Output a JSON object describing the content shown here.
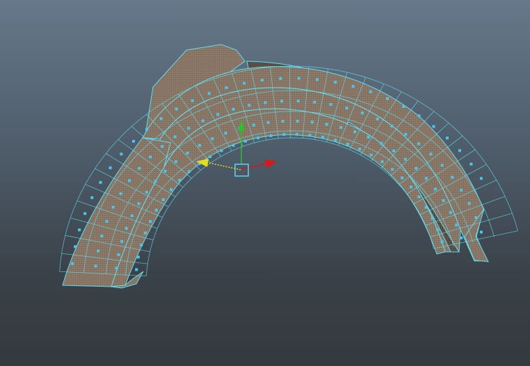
{
  "viewport": {
    "background_top": "#66788a",
    "background_bottom": "#34393e"
  },
  "mesh": {
    "object": "arch-mesh",
    "surface_color": "#8a7665",
    "surface_dark": "#5a4c42",
    "wire_color": "#5ee0f5",
    "vertex_color": "#45c8f0"
  },
  "manipulator": {
    "x_axis_color": "#d41a1a",
    "y_axis_color": "#29c229",
    "z_axis_color": "#e6dc1a",
    "center_color": "#5fd4f0"
  }
}
